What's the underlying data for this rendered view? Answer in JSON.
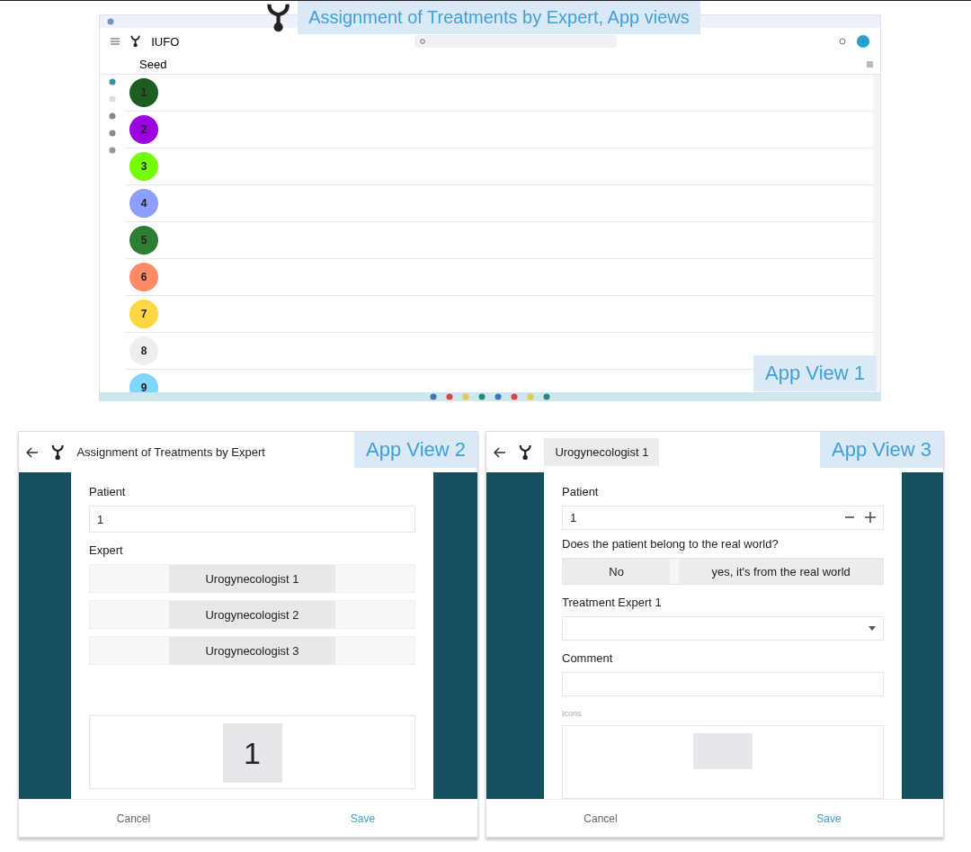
{
  "title": "Assignment of Treatments by Expert, App views",
  "view1": {
    "label": "App View 1",
    "app_name": "IUFO",
    "section": "Seed",
    "items": [
      {
        "number": "1",
        "color": "#1b5e20"
      },
      {
        "number": "2",
        "color": "#9c00e0"
      },
      {
        "number": "3",
        "color": "#76ff03"
      },
      {
        "number": "4",
        "color": "#8c9eff"
      },
      {
        "number": "5",
        "color": "#2e7d32"
      },
      {
        "number": "6",
        "color": "#ff8a65"
      },
      {
        "number": "7",
        "color": "#ffd740"
      },
      {
        "number": "8",
        "color": "#eeeeee"
      },
      {
        "number": "9",
        "color": "#81d4fa"
      }
    ]
  },
  "view2": {
    "label": "App View 2",
    "title": "Assignment of Treatments by Expert",
    "patient_label": "Patient",
    "patient_value": "1",
    "expert_label": "Expert",
    "experts": [
      {
        "name": "Urogynecologist 1"
      },
      {
        "name": "Urogynecologist 2"
      },
      {
        "name": "Urogynecologist 3"
      }
    ],
    "image_number": "1",
    "buttons": [
      "Cancel",
      "Save"
    ]
  },
  "view3": {
    "label": "App View 3",
    "title": "Urogynecologist 1",
    "patient_label": "Patient",
    "patient_value": "1",
    "question": "Does the patient belong to the real world?",
    "options": [
      {
        "label": "No"
      },
      {
        "label": "yes, it's from the real world"
      }
    ],
    "treatment_label": "Treatment Expert 1",
    "comment_label": "Comment",
    "icons_label": "Icons",
    "buttons": [
      "Cancel",
      "Save"
    ]
  }
}
